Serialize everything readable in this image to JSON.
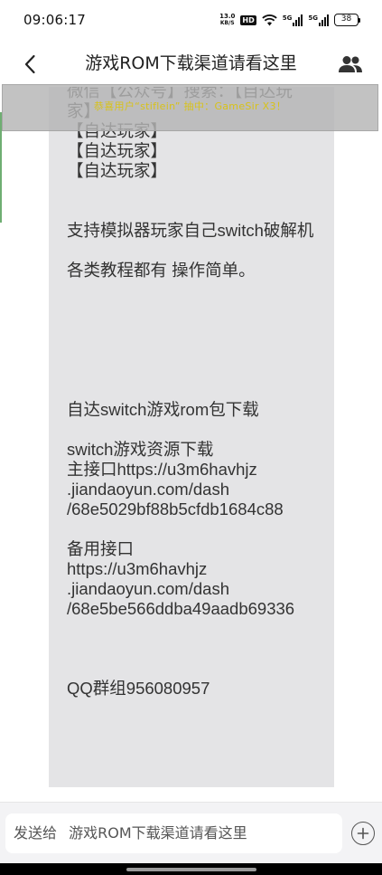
{
  "status_bar": {
    "time": "09:06:17",
    "net_speed_value": "13.0",
    "net_speed_unit": "KB/S",
    "hd_badge": "HD",
    "signal1_label": "5G",
    "signal2_label": "5G",
    "battery": "38"
  },
  "nav": {
    "title": "游戏ROM下载渠道请看这里",
    "back_icon": "chevron-left-icon",
    "members_icon": "group-icon"
  },
  "notice": {
    "text": "恭喜用户“stiflein” 抽中：GameSir X3！"
  },
  "message": {
    "text": "微信【公众号】搜索：【自达玩家】\n【自达玩家】\n【自达玩家】\n【自达玩家】\n\n\n支持模拟器玩家自己switch破解机\n\n各类教程都有 操作简单。\n\n\n\n\n\n\n自达switch游戏rom包下载\n\nswitch游戏资源下载\n主接口https://u3m6havhjz\n.jiandaoyun.com/dash\n/68e5029bf88b5cfdb1684c88\n\n备用接口\nhttps://u3m6havhjz\n.jiandaoyun.com/dash\n/68e5be566ddba49aadb69336\n\n\n\nQQ群组956080957"
  },
  "input": {
    "prefix": "发送给",
    "target": "游戏ROM下载渠道请看这里",
    "plus_icon": "plus-circle-icon"
  },
  "colors": {
    "bubble": "#e4e4e6",
    "notice_text": "#d8c21a",
    "accent": "#6fae72"
  }
}
